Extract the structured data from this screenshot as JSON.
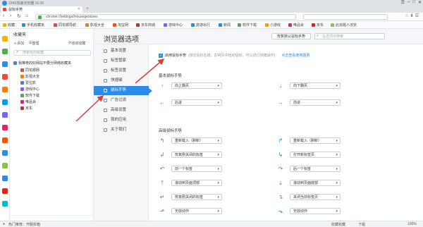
{
  "window": {
    "title": "2345加速浏览器 10.26"
  },
  "tab": {
    "label": "鼠标手势"
  },
  "address": {
    "url": "chrome://settings/mousegestures"
  },
  "colors": {
    "accent": "#2a8ce8",
    "annotation": "#e53935"
  },
  "bookmarks": [
    {
      "label": "收藏",
      "color": "#f4b400"
    },
    {
      "label": "手机收藏夹",
      "color": "#2a8ce8"
    },
    {
      "label": "同花顺导航",
      "color": "#e84a3d"
    },
    {
      "label": "影视大全",
      "color": "#ff7a00"
    },
    {
      "label": "淘宝网",
      "color": "#ff5000"
    },
    {
      "label": "京东商城",
      "color": "#e1251b"
    },
    {
      "label": "游戏中心",
      "color": "#7b61ff"
    },
    {
      "label": "旅游出行",
      "color": "#00a0e9"
    },
    {
      "label": "新闻",
      "color": "#2a8ce8"
    },
    {
      "label": "软件下载",
      "color": "#4caf50"
    },
    {
      "label": "小游戏",
      "color": "#ff9800"
    },
    {
      "label": "唯品会",
      "color": "#e91e63"
    },
    {
      "label": "京东",
      "color": "#e1251b"
    },
    {
      "label": "此追题人浏览",
      "color": "#8bc34a"
    }
  ],
  "favorites": {
    "title": "收藏夹",
    "add": "添加",
    "organize": "整理",
    "collapse": "收收收藏",
    "search_placeholder": "搜索我的收藏",
    "root": "我推荐的好网站不要分网络收藏夹",
    "items": [
      {
        "label": "同花顺网",
        "color": "#e84a3d"
      },
      {
        "label": "影视大全",
        "color": "#ff7a00"
      },
      {
        "label": "爱拉影",
        "color": "#2a8ce8"
      },
      {
        "label": "游戏中心",
        "color": "#7b61ff"
      },
      {
        "label": "软件下载",
        "color": "#4caf50"
      },
      {
        "label": "唯品会",
        "color": "#e91e63"
      },
      {
        "label": "京东",
        "color": "#e1251b"
      }
    ]
  },
  "settings": {
    "title": "浏览器选项",
    "restore_button": "恢复默认鼠标手势",
    "search_placeholder": "在选项中搜索",
    "nav": [
      {
        "label": "基本设置",
        "active": false
      },
      {
        "label": "标签管家",
        "active": false
      },
      {
        "label": "标签设置",
        "active": false
      },
      {
        "label": "快捷键",
        "active": false
      },
      {
        "label": "鼠标手势",
        "active": true
      },
      {
        "label": "广告过滤",
        "active": false
      },
      {
        "label": "高级设置",
        "active": false
      },
      {
        "label": "我的应用",
        "active": false
      },
      {
        "label": "关于我们",
        "active": false
      }
    ],
    "enable_label": "启用鼠标手势",
    "enable_hint": "(按住鼠标右键，在网页中拖动鼠标，可以进行快捷操作)",
    "help_link": "点击查看使用图例",
    "basic_section": "基本鼠标手势",
    "advanced_section": "高级鼠标手势",
    "basic": [
      {
        "arrow": "↑",
        "action": "向上翻页"
      },
      {
        "arrow": "↓",
        "action": "向下翻页"
      },
      {
        "arrow": "←",
        "action": "后退"
      },
      {
        "arrow": "→",
        "action": "前进"
      }
    ],
    "advanced": [
      {
        "arrow": "↰",
        "action": "重新载入（刷新）"
      },
      {
        "arrow": "↱",
        "action": "重新载入（刷新）"
      },
      {
        "arrow": "↲",
        "action": "恢复刚关闭的标签"
      },
      {
        "arrow": "↳",
        "action": "打开新标签页"
      },
      {
        "arrow": "↶",
        "action": "前一个标签"
      },
      {
        "arrow": "↷",
        "action": "后一个标签"
      },
      {
        "arrow": "⤒",
        "action": "滚动到页面顶部"
      },
      {
        "arrow": "⤓",
        "action": "滚动到页面底部"
      },
      {
        "arrow": "↵",
        "action": "恢复刚关闭的标签"
      },
      {
        "arrow": "↴",
        "action": "关闭当前标签页"
      },
      {
        "arrow": "⬏",
        "action": "无效动作"
      },
      {
        "arrow": "⬎",
        "action": "无效动作"
      }
    ]
  },
  "status": {
    "left": "热门推荐：开服拆箱",
    "collect": "收藏收藏",
    "download": "下载",
    "zoom": "100%"
  }
}
